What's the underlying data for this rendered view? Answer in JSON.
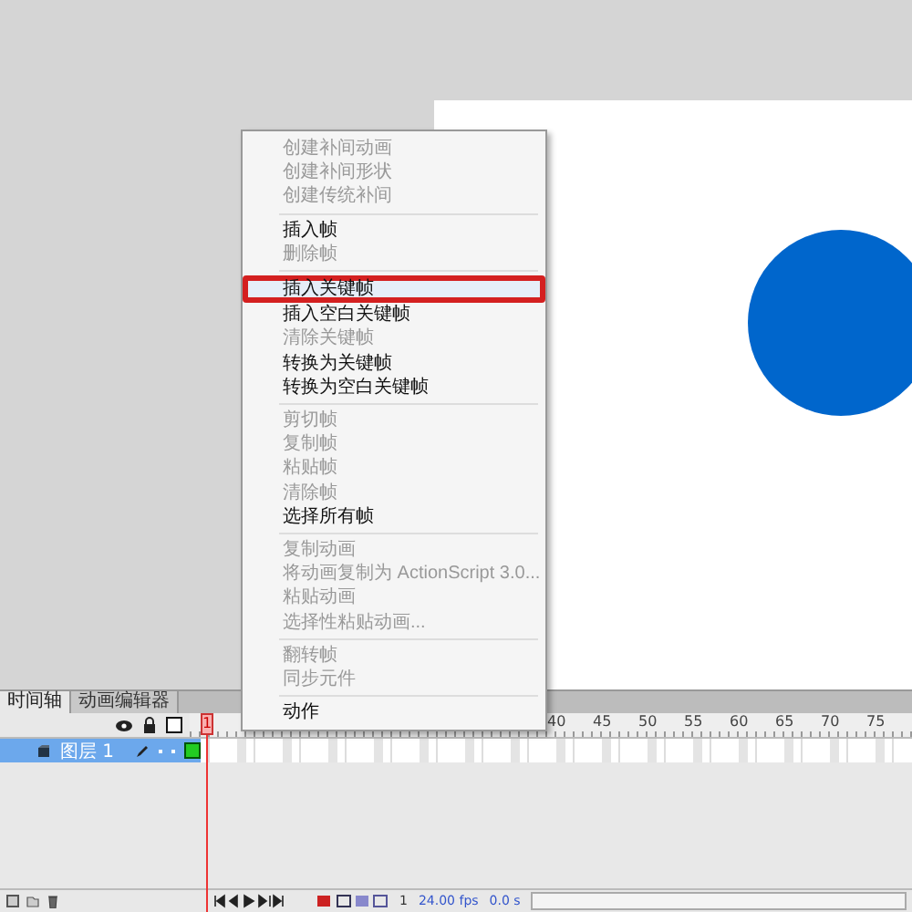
{
  "context_menu": {
    "items": [
      {
        "label": "创建补间动画",
        "disabled": true,
        "selected": false,
        "separator_after": false
      },
      {
        "label": "创建补间形状",
        "disabled": true,
        "selected": false,
        "separator_after": false
      },
      {
        "label": "创建传统补间",
        "disabled": true,
        "selected": false,
        "separator_after": true
      },
      {
        "label": "插入帧",
        "disabled": false,
        "selected": false,
        "separator_after": false
      },
      {
        "label": "删除帧",
        "disabled": true,
        "selected": false,
        "separator_after": true
      },
      {
        "label": "插入关键帧",
        "disabled": false,
        "selected": true,
        "separator_after": false
      },
      {
        "label": "插入空白关键帧",
        "disabled": false,
        "selected": false,
        "separator_after": false
      },
      {
        "label": "清除关键帧",
        "disabled": true,
        "selected": false,
        "separator_after": false
      },
      {
        "label": "转换为关键帧",
        "disabled": false,
        "selected": false,
        "separator_after": false
      },
      {
        "label": "转换为空白关键帧",
        "disabled": false,
        "selected": false,
        "separator_after": true
      },
      {
        "label": "剪切帧",
        "disabled": true,
        "selected": false,
        "separator_after": false
      },
      {
        "label": "复制帧",
        "disabled": true,
        "selected": false,
        "separator_after": false
      },
      {
        "label": "粘贴帧",
        "disabled": true,
        "selected": false,
        "separator_after": false
      },
      {
        "label": "清除帧",
        "disabled": true,
        "selected": false,
        "separator_after": false
      },
      {
        "label": "选择所有帧",
        "disabled": false,
        "selected": false,
        "separator_after": true
      },
      {
        "label": "复制动画",
        "disabled": true,
        "selected": false,
        "separator_after": false
      },
      {
        "label": "将动画复制为 ActionScript 3.0...",
        "disabled": true,
        "selected": false,
        "separator_after": false
      },
      {
        "label": "粘贴动画",
        "disabled": true,
        "selected": false,
        "separator_after": false
      },
      {
        "label": "选择性粘贴动画...",
        "disabled": true,
        "selected": false,
        "separator_after": true
      },
      {
        "label": "翻转帧",
        "disabled": true,
        "selected": false,
        "separator_after": false
      },
      {
        "label": "同步元件",
        "disabled": true,
        "selected": false,
        "separator_after": true
      },
      {
        "label": "动作",
        "disabled": false,
        "selected": false,
        "separator_after": false
      }
    ]
  },
  "timeline": {
    "tabs": [
      {
        "label": "时间轴",
        "selected": true
      },
      {
        "label": "动画编辑器",
        "selected": false
      }
    ],
    "ruler": [
      "40",
      "45",
      "50",
      "55",
      "60",
      "65",
      "70",
      "75"
    ],
    "playhead": "1",
    "layers": [
      {
        "name": "图层 1",
        "selected": true
      }
    ],
    "status": {
      "frame": "1",
      "fps": "24.00 fps",
      "time": "0.0 s"
    }
  }
}
